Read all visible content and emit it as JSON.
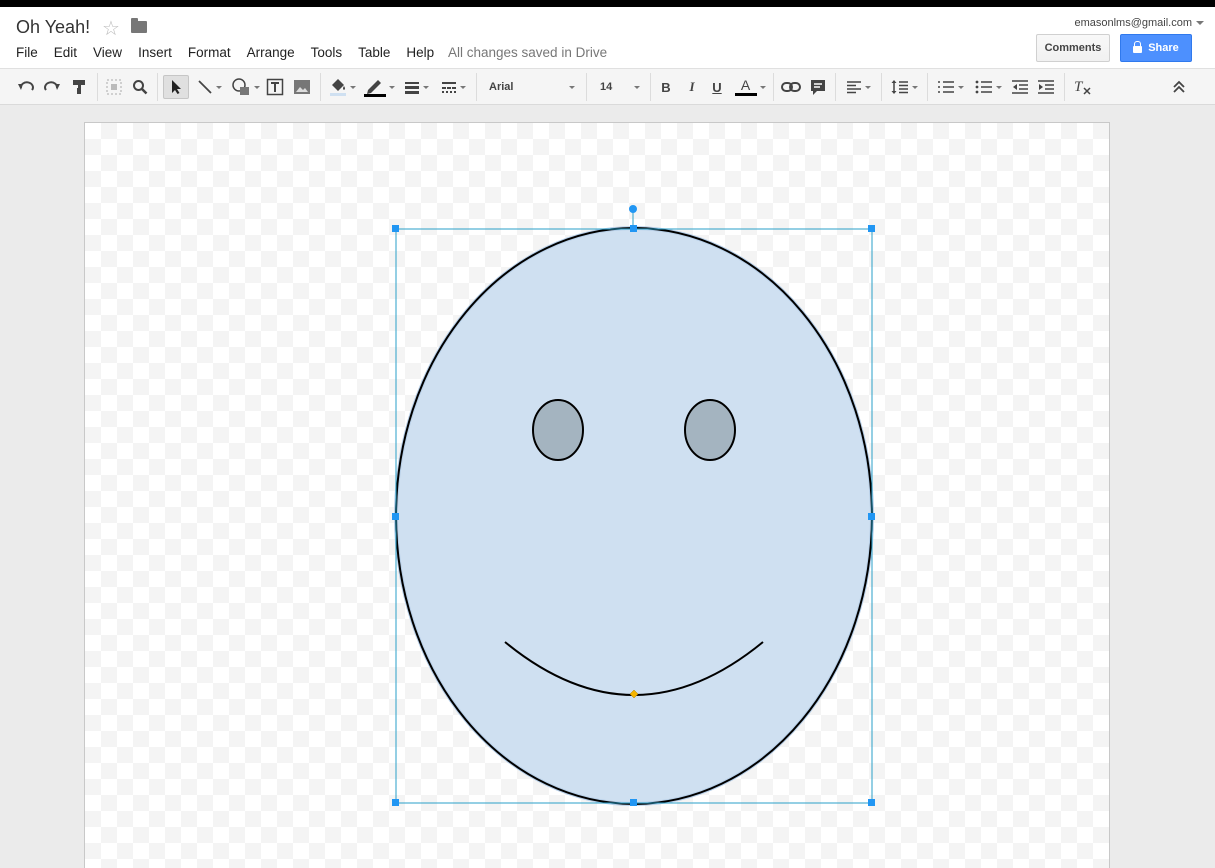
{
  "header": {
    "title": "Oh Yeah!",
    "account": "emasonlms@gmail.com",
    "saved_status": "All changes saved in Drive",
    "comments_label": "Comments",
    "share_label": "Share"
  },
  "menu": [
    "File",
    "Edit",
    "View",
    "Insert",
    "Format",
    "Arrange",
    "Tools",
    "Table",
    "Help"
  ],
  "toolbar": {
    "font_family": "Arial",
    "font_size": "14",
    "bold": "B",
    "italic": "I",
    "underline": "U",
    "text_color": "A"
  },
  "colors": {
    "face_fill": "#cfe0f1",
    "eye_fill": "#a4b4c0",
    "selection": "#2196f3",
    "share_button": "#4d90fe"
  }
}
